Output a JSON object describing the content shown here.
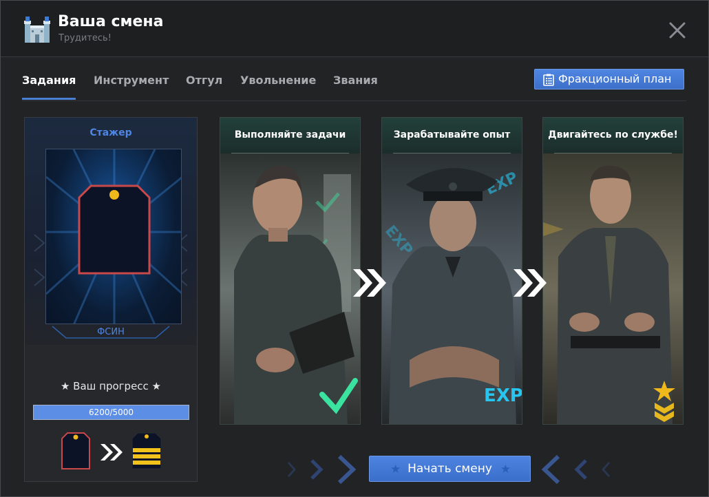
{
  "window": {
    "title": "Ваша смена",
    "subtitle": "Трудитесь!"
  },
  "tabs": [
    {
      "label": "Задания",
      "active": true
    },
    {
      "label": "Инструмент",
      "active": false
    },
    {
      "label": "Отгул",
      "active": false
    },
    {
      "label": "Увольнение",
      "active": false
    },
    {
      "label": "Звания",
      "active": false
    }
  ],
  "faction_plan_button": {
    "label": "Фракционный план",
    "icon": "clipboard-list-icon"
  },
  "rank_card": {
    "rank_name": "Стажер",
    "organization": "ФСИН",
    "progress_label": "★ Ваш прогресс ★",
    "progress_text": "6200/5000",
    "progress_fraction": 1.0,
    "current_rank_icon": "empty-epaulette-icon",
    "next_rank_icon": "striped-epaulette-icon"
  },
  "steps": [
    {
      "title": "Выполняйте задачи",
      "badge_icon": "checkmark-icon"
    },
    {
      "title": "Зарабатывайте опыт",
      "badge_icon": "exp-icon",
      "badge_text": "EXP"
    },
    {
      "title": "Двигайтесь по службе!",
      "badge_icon": "rank-chevron-star-icon"
    }
  ],
  "start_button": {
    "label": "Начать смену"
  },
  "colors": {
    "accent": "#4a7fd6",
    "button": "#4a80dc",
    "check": "#3be3a0",
    "exp": "#27c6f0",
    "gold": "#e6b81e",
    "epaulette_border": "#c9484a"
  }
}
